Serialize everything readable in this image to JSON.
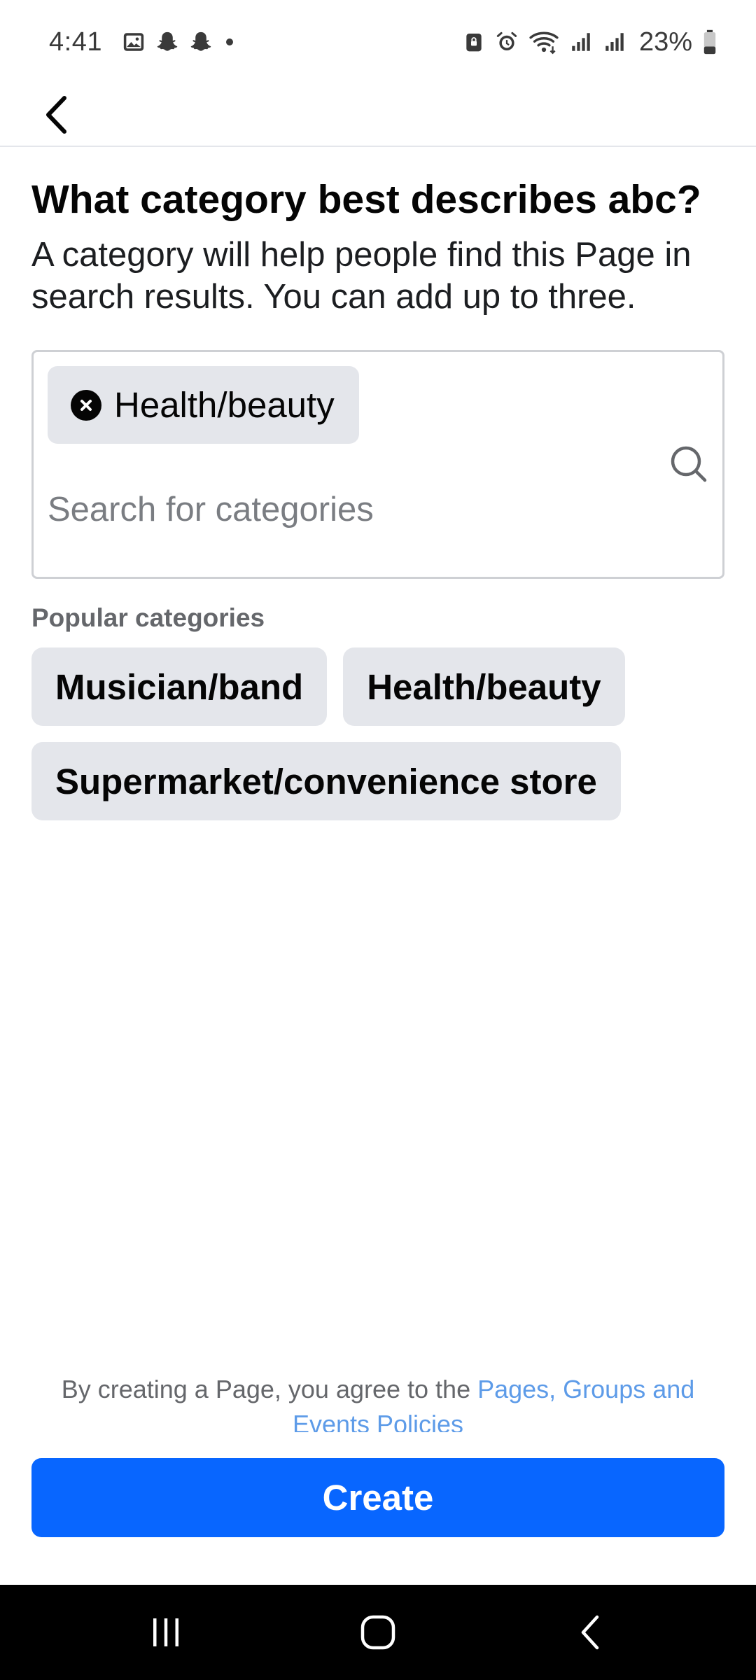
{
  "status_bar": {
    "time": "4:41",
    "battery_percent": "23%",
    "icons_left": [
      "gallery-icon",
      "snapchat-icon",
      "snapchat-icon",
      "notification-dot-icon"
    ],
    "icons_right": [
      "nfc-lock-icon",
      "alarm-icon",
      "wifi-icon",
      "signal-icon",
      "signal-icon",
      "battery-icon"
    ]
  },
  "app_bar": {
    "back_icon": "chevron-left-icon"
  },
  "page": {
    "title": "What category best describes abc?",
    "subtitle": "A category will help people find this Page in search results. You can add up to three."
  },
  "category_field": {
    "selected": [
      {
        "label": "Health/beauty",
        "remove_icon": "close-circle-icon"
      }
    ],
    "search_placeholder": "Search for categories",
    "search_value": "",
    "search_icon": "search-icon"
  },
  "popular": {
    "label": "Popular categories",
    "items": [
      "Musician/band",
      "Health/beauty",
      "Supermarket/convenience store"
    ]
  },
  "terms": {
    "text": "By creating a Page, you agree to the ",
    "link": "Pages, Groups and Events Policies"
  },
  "create_button": {
    "label": "Create"
  },
  "colors": {
    "primary": "#0866ff",
    "chip_bg": "#e4e6eb",
    "link": "#5d9be8",
    "secondary_text": "#65676b"
  },
  "nav_bar": {
    "items": [
      "recent-apps-icon",
      "home-icon",
      "back-icon"
    ]
  }
}
